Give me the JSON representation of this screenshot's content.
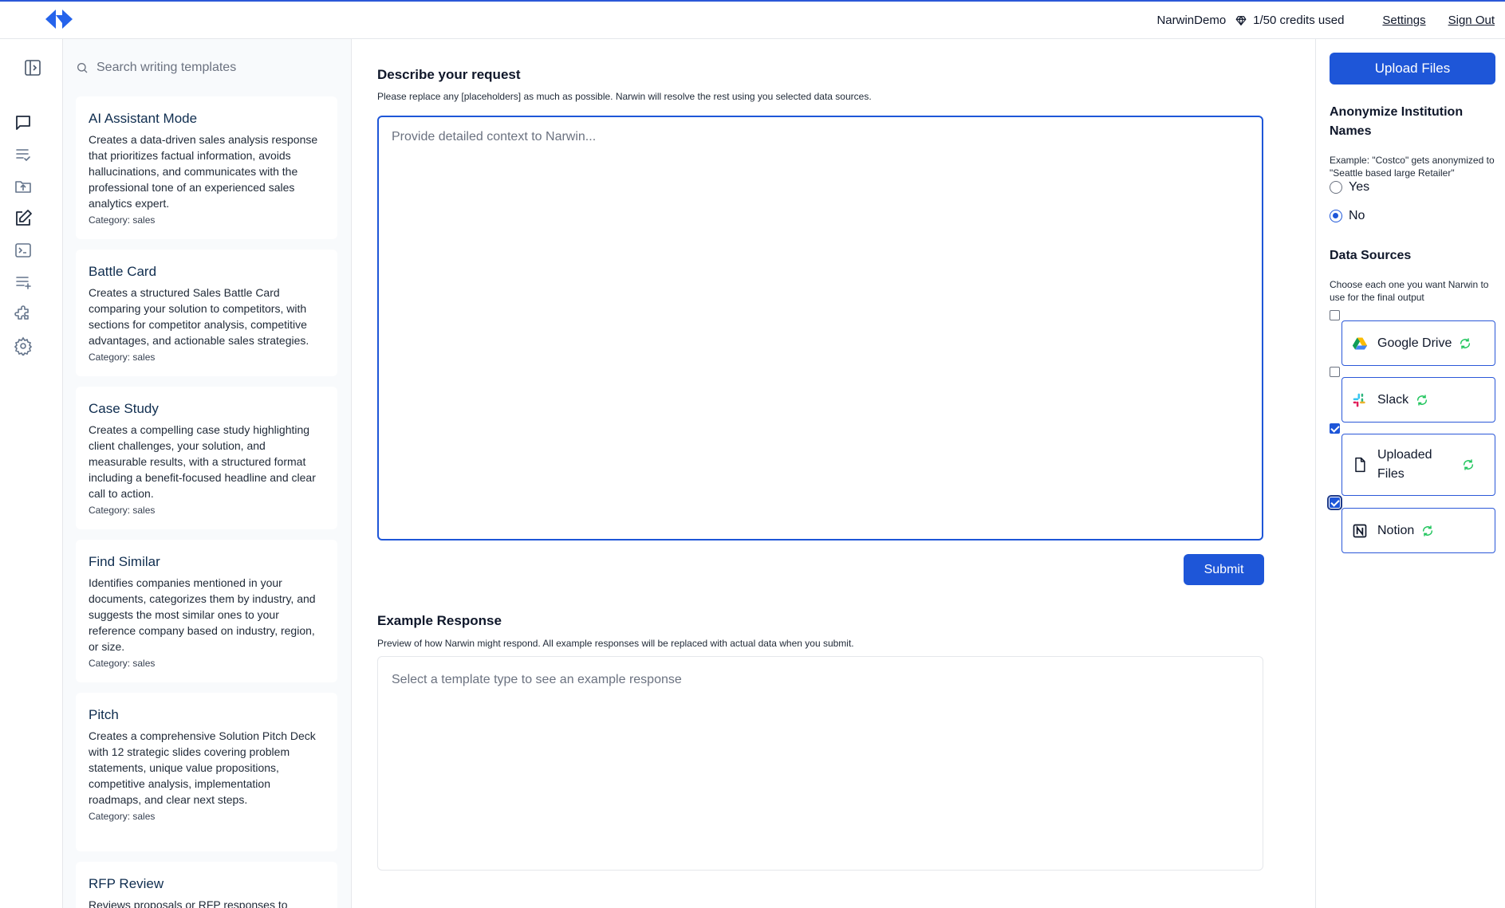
{
  "header": {
    "username": "NarwinDemo",
    "credits": "1/50 credits used",
    "settings_label": "Settings",
    "signout_label": "Sign Out"
  },
  "rail": {
    "icons": [
      "sidebar-toggle-icon",
      "chat-icon",
      "list-check-icon",
      "folder-upload-icon",
      "edit-icon",
      "terminal-icon",
      "list-add-icon",
      "puzzle-icon",
      "gear-icon"
    ]
  },
  "templates": {
    "search_placeholder": "Search writing templates",
    "items": [
      {
        "title": "AI Assistant Mode",
        "description": "Creates a data-driven sales analysis response that prioritizes factual information, avoids hallucinations, and communicates with the professional tone of an experienced sales analytics expert.",
        "category": "Category: sales"
      },
      {
        "title": "Battle Card",
        "description": "Creates a structured Sales Battle Card comparing your solution to competitors, with sections for competitor analysis, competitive advantages, and actionable sales strategies.",
        "category": "Category: sales"
      },
      {
        "title": "Case Study",
        "description": "Creates a compelling case study highlighting client challenges, your solution, and measurable results, with a structured format including a benefit-focused headline and clear call to action.",
        "category": "Category: sales"
      },
      {
        "title": "Find Similar",
        "description": "Identifies companies mentioned in your documents, categorizes them by industry, and suggests the most similar ones to your reference company based on industry, region, or size.",
        "category": "Category: sales"
      },
      {
        "title": "Pitch",
        "description": "Creates a comprehensive Solution Pitch Deck with 12 strategic slides covering problem statements, unique value propositions, competitive analysis, implementation roadmaps, and clear next steps.",
        "category": "Category: sales"
      },
      {
        "title": "RFP Review",
        "description": "Reviews proposals or RFP responses to",
        "category": ""
      }
    ]
  },
  "request": {
    "title": "Describe your request",
    "help": "Please replace any [placeholders] as much as possible. Narwin will resolve the rest using you selected data sources.",
    "placeholder": "Provide detailed context to Narwin...",
    "submit_label": "Submit"
  },
  "example": {
    "title": "Example Response",
    "help": "Preview of how Narwin might respond. All example responses will be replaced with actual data when you submit.",
    "placeholder": "Select a template type to see an example response"
  },
  "sidebar": {
    "upload_label": "Upload Files",
    "anonymize": {
      "title": "Anonymize Institution Names",
      "help": "Example: \"Costco\" gets anonymized to \"Seattle based large Retailer\"",
      "options": [
        {
          "label": "Yes",
          "selected": false
        },
        {
          "label": "No",
          "selected": true
        }
      ]
    },
    "data_sources": {
      "title": "Data Sources",
      "help": "Choose each one you want Narwin to use for the final output",
      "items": [
        {
          "label": "Google Drive",
          "checked": false,
          "icon": "google-drive-icon"
        },
        {
          "label": "Slack",
          "checked": false,
          "icon": "slack-icon"
        },
        {
          "label": "Uploaded Files",
          "checked": true,
          "icon": "file-icon"
        },
        {
          "label": "Notion",
          "checked": true,
          "icon": "notion-icon"
        }
      ]
    }
  },
  "colors": {
    "accent": "#1e56d8",
    "sync_green": "#22c55e",
    "panel_bg": "#f8fafc"
  }
}
